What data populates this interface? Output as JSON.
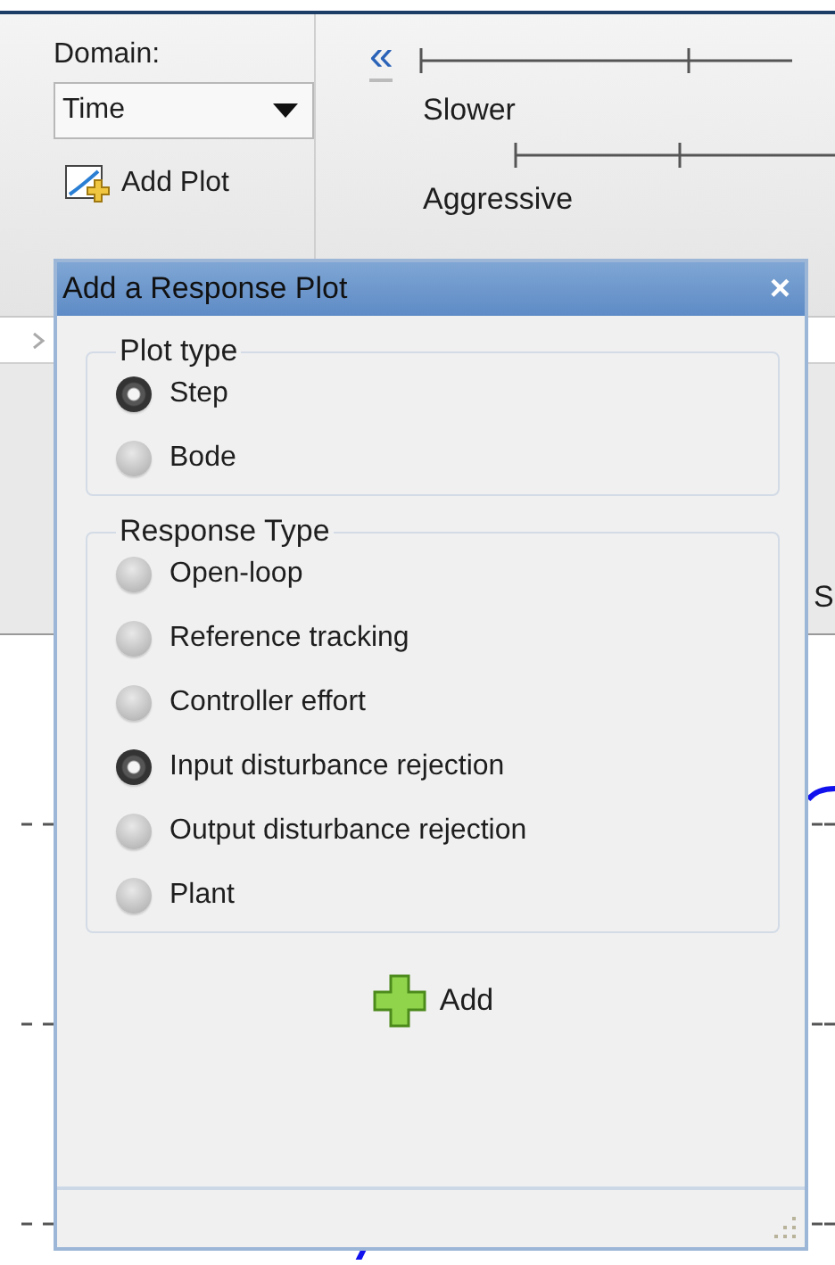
{
  "toolstrip": {
    "domain_label": "Domain:",
    "domain_value": "Time",
    "add_plot": "Add Plot",
    "collapse": "«",
    "slider_labels": [
      "Slower",
      "Aggressive"
    ]
  },
  "side_label": "S",
  "dialog": {
    "title": "Add a Response Plot",
    "close": "×",
    "groups": [
      {
        "legend": "Plot type",
        "options": [
          {
            "label": "Step",
            "selected": true
          },
          {
            "label": "Bode",
            "selected": false
          }
        ]
      },
      {
        "legend": "Response Type",
        "options": [
          {
            "label": "Open-loop",
            "selected": false
          },
          {
            "label": "Reference tracking",
            "selected": false
          },
          {
            "label": "Controller effort",
            "selected": false
          },
          {
            "label": "Input disturbance rejection",
            "selected": true
          },
          {
            "label": "Output disturbance rejection",
            "selected": false
          },
          {
            "label": "Plant",
            "selected": false
          }
        ]
      }
    ],
    "add_button": "Add"
  }
}
